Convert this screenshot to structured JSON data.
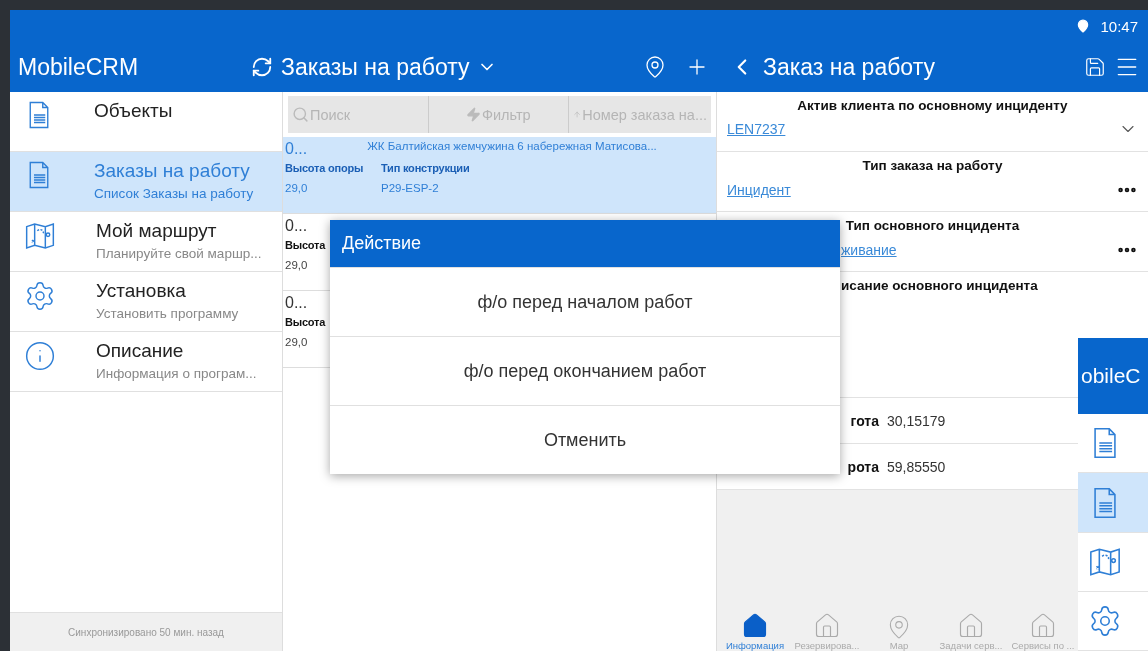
{
  "status_bar": {
    "time": "10:47"
  },
  "app_bar": {
    "app_title": "MobileCRM",
    "list_title": "Заказы на работу",
    "detail_title": "Заказ на работу"
  },
  "sidebar": {
    "items": [
      {
        "kind": "document",
        "title": "Объекты",
        "selected": false
      },
      {
        "kind": "document",
        "title": "Заказы на работу",
        "subtitle": "Список Заказы на работу",
        "selected": true
      },
      {
        "kind": "map",
        "title": "Мой маршрут",
        "subtitle": "Планируйте свой маршр...",
        "selected": false
      },
      {
        "kind": "settings",
        "title": "Установка",
        "subtitle": "Установить программу",
        "selected": false
      },
      {
        "kind": "info",
        "title": "Описание",
        "subtitle": "Информация о програм...",
        "selected": false
      }
    ],
    "sync_status": "Синхронизировано 50 мин. назад"
  },
  "list": {
    "search_placeholder": "Поиск",
    "filter": "Фильтр",
    "sort": "Номер заказа на...",
    "rows": [
      {
        "number": "0...",
        "address": "ЖК Балтийская жемчужина 6 набережная Матисова...",
        "selected": true,
        "fields": [
          {
            "label": "Высота опоры",
            "value": "29,0"
          },
          {
            "label": "Тип конструкции",
            "value": "P29-ESP-2"
          }
        ]
      },
      {
        "number": "0...",
        "selected": false,
        "fields": [
          {
            "label": "Высота",
            "value": "29,0"
          }
        ]
      },
      {
        "number": "0...",
        "selected": false,
        "fields": [
          {
            "label": "Высота",
            "value": "29,0"
          }
        ]
      }
    ]
  },
  "detail": {
    "fields": [
      {
        "kind": "dropdown",
        "label": "Актив клиента по основному инциденту",
        "value": "LEN7237"
      },
      {
        "kind": "lookup",
        "label": "Тип заказа на работу",
        "value": "Инцидент"
      },
      {
        "kind": "lookup",
        "label": "Тип основного инцидента",
        "value": "живание"
      },
      {
        "kind": "text",
        "label": "исание основного инцидента"
      },
      {
        "kind": "coordinate",
        "label": "гота",
        "value": "30,15179"
      },
      {
        "kind": "coordinate",
        "label": "рота",
        "value": "59,85550"
      }
    ],
    "tabs": [
      {
        "kind": "home",
        "label": "Информация",
        "selected": true
      },
      {
        "kind": "home",
        "label": "Резервирова...",
        "selected": false
      },
      {
        "kind": "pin",
        "label": "Мар",
        "selected": false
      },
      {
        "kind": "home",
        "label": "Задачи серв...",
        "selected": false
      },
      {
        "kind": "home",
        "label": "Сервисы по ...",
        "selected": false
      }
    ]
  },
  "dialog": {
    "title": "Действие",
    "options": [
      "ф/о перед началом работ",
      "ф/о перед окончанием работ",
      "Отменить"
    ]
  },
  "background_window": {
    "title": "obileC",
    "items": [
      {
        "kind": "document",
        "selected": false
      },
      {
        "kind": "document",
        "selected": true
      },
      {
        "kind": "map",
        "selected": false
      },
      {
        "kind": "settings",
        "selected": false
      }
    ]
  }
}
